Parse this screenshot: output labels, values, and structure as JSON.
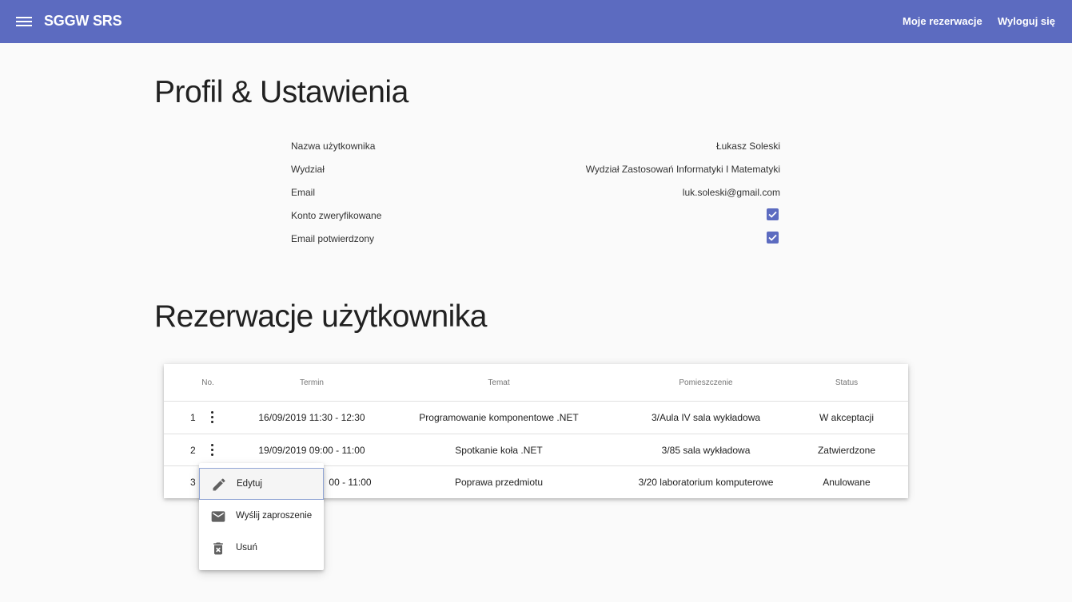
{
  "toolbar": {
    "title": "SGGW SRS",
    "links": [
      "Moje rezerwacje",
      "Wyloguj się"
    ]
  },
  "profile": {
    "heading": "Profil & Ustawienia",
    "rows": [
      {
        "label": "Nazwa użytkownika",
        "value": "Łukasz Soleski"
      },
      {
        "label": "Wydział",
        "value": "Wydział Zastosowań Informatyki I Matematyki"
      },
      {
        "label": "Email",
        "value": "luk.soleski@gmail.com"
      },
      {
        "label": "Konto zweryfikowane",
        "checked": true
      },
      {
        "label": "Email potwierdzony",
        "checked": true
      }
    ]
  },
  "reservations": {
    "heading": "Rezerwacje użytkownika",
    "columns": [
      "No.",
      "Termin",
      "Temat",
      "Pomieszczenie",
      "Status"
    ],
    "rows": [
      {
        "no": "1",
        "termin": "16/09/2019 11:30 - 12:30",
        "temat": "Programowanie komponentowe .NET",
        "pomieszczenie": "3/Aula IV sala wykładowa",
        "status": "W akceptacji"
      },
      {
        "no": "2",
        "termin": "19/09/2019 09:00 - 11:00",
        "temat": "Spotkanie koła .NET",
        "pomieszczenie": "3/85 sala wykładowa",
        "status": "Zatwierdzone"
      },
      {
        "no": "3",
        "termin": "00 - 11:00",
        "temat": "Poprawa przedmiotu",
        "pomieszczenie": "3/20 laboratorium komputerowe",
        "status": "Anulowane"
      }
    ]
  },
  "context_menu": {
    "items": [
      {
        "label": "Edytuj",
        "icon": "pencil-icon"
      },
      {
        "label": "Wyślij zaproszenie",
        "icon": "mail-icon"
      },
      {
        "label": "Usuń",
        "icon": "delete-icon"
      }
    ]
  },
  "colors": {
    "primary": "#5c6bc0",
    "background": "#fafafa"
  }
}
